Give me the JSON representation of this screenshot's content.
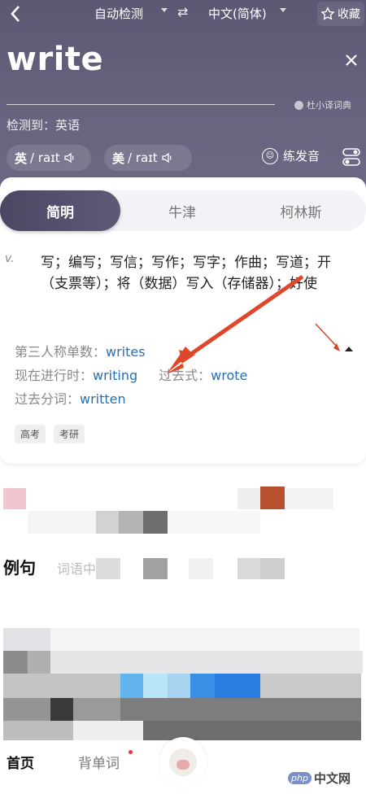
{
  "header": {
    "source_lang": "自动检测",
    "target_lang": "中文(简体)",
    "favorite_label": "收藏",
    "query_word": "write",
    "brand": "杜小译词典",
    "detected_label": "检测到：英语"
  },
  "pronunciation": {
    "uk_label": "英",
    "uk_ipa": "/ raɪt",
    "us_label": "美",
    "us_ipa": "/ raɪt",
    "practice_label": "练发音"
  },
  "tabs": [
    "简明",
    "牛津",
    "柯林斯"
  ],
  "definition": {
    "pos": "v.",
    "text": "写；编写；写信；写作；写字；作曲；写道；开（支票等）；将（数据）写入（存储器）；好使"
  },
  "forms": {
    "third_person_label": "第三人称单数：",
    "third_person_value": "writes",
    "present_participle_label": "现在进行时：",
    "present_participle_value": "writing",
    "past_label": "过去式：",
    "past_value": "wrote",
    "past_participle_label": "过去分词：",
    "past_participle_value": "written"
  },
  "tags": [
    "高考",
    "考研"
  ],
  "examples": {
    "title": "例句",
    "tab_label": "词语中"
  },
  "bottom_nav": {
    "home": "首页",
    "words": "背单词"
  },
  "watermark": {
    "badge": "php",
    "text": "中文网"
  },
  "colors": {
    "header_bg": "#5e5774",
    "link": "#2a6fb0",
    "arrow": "#e0472a"
  }
}
